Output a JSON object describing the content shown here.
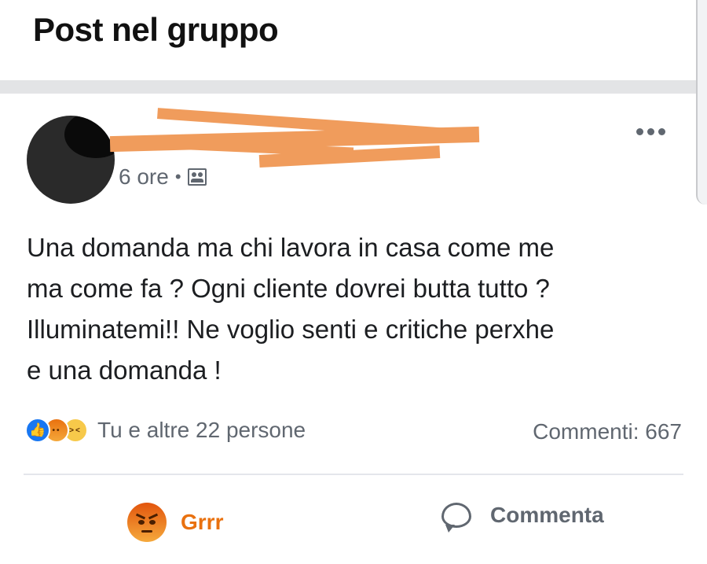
{
  "header": {
    "title": "Post nel gruppo"
  },
  "post": {
    "time": "6 ore",
    "separator": "•",
    "visibility_icon": "group-icon",
    "text": [
      "Una domanda ma chi lavora in casa come me",
      "ma come fa ? Ogni cliente dovrei butta tutto ?",
      "Illuminatemi!! Ne voglio senti e critiche perxhe",
      "e una domanda !"
    ],
    "reactions": {
      "icons": [
        "like-icon",
        "angry-icon",
        "haha-icon"
      ],
      "summary": "Tu e altre 22 persone"
    },
    "comments_count": "Commenti: 667",
    "actions": {
      "reaction_label": "Grrr",
      "comment_label": "Commenta"
    }
  },
  "colors": {
    "like_blue": "#1877f2",
    "angry_orange": "#e9710f",
    "redaction_orange": "#f09c5c",
    "secondary_text": "#606770"
  }
}
